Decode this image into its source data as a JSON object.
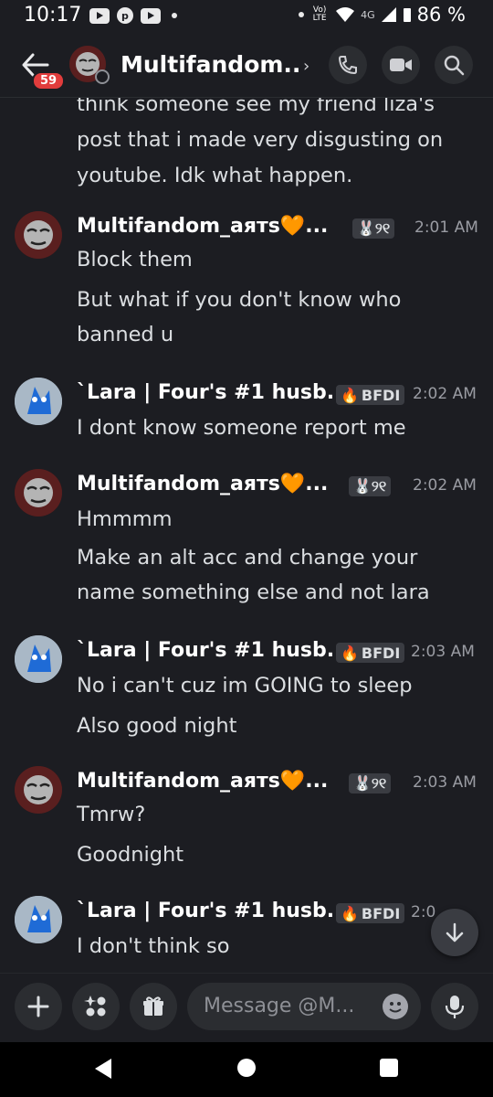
{
  "status_bar": {
    "time": "10:17",
    "network": "4G",
    "volte": "Vo) LTE",
    "battery": "86 %",
    "icons": [
      "youtube-icon",
      "pinterest-icon",
      "youtube-icon",
      "dot-icon",
      "wifi-icon",
      "signal-icon",
      "battery-icon"
    ]
  },
  "header": {
    "badge_count": "59",
    "title": "Multifandom..",
    "chevron": "›",
    "buttons": [
      "call-icon",
      "video-icon",
      "search-icon"
    ]
  },
  "messages": {
    "cut_off_text": "think someone see my friend liza's post that i made very disgusting on youtube. Idk what happen.",
    "groups": [
      {
        "author": "Multifandom_аятѕ🧡...",
        "tag": "🐰୨୧",
        "time": "2:01 AM",
        "lines": [
          "Block them",
          "But what if you don't know  who",
          "banned u"
        ]
      },
      {
        "author": "`Lara | Four's #1 husb...",
        "tag": "BFDI",
        "time": "2:02 AM",
        "lines": [
          "I dont know someone report me"
        ]
      },
      {
        "author": "Multifandom_аятѕ🧡...",
        "tag": "🐰୨୧",
        "time": "2:02 AM",
        "lines": [
          "Hmmmm",
          "Make an alt acc and change your",
          "name something else and not lara"
        ]
      },
      {
        "author": "`Lara | Four's #1 husb...",
        "tag": "BFDI",
        "time": "2:03 AM",
        "lines": [
          "No i can't cuz im GOING to sleep",
          "Also good night"
        ]
      },
      {
        "author": "Multifandom_аятѕ🧡...",
        "tag": "🐰୨୧",
        "time": "2:03 AM",
        "lines": [
          "Tmrw?",
          "Goodnight"
        ]
      },
      {
        "author": "`Lara | Four's #1 husb...",
        "tag": "BFDI",
        "time": "2:0",
        "lines": [
          "I don't think so"
        ]
      }
    ]
  },
  "composer": {
    "placeholder": "Message @M...",
    "buttons": [
      "plus-icon",
      "apps-icon",
      "gift-icon",
      "emoji-icon",
      "microphone-icon"
    ]
  },
  "colors": {
    "background": "#1c1d22",
    "badge": "#e13c3c",
    "button_bg": "#2b2d31",
    "text": "#dbdee1",
    "muted": "#9a9ca3"
  }
}
